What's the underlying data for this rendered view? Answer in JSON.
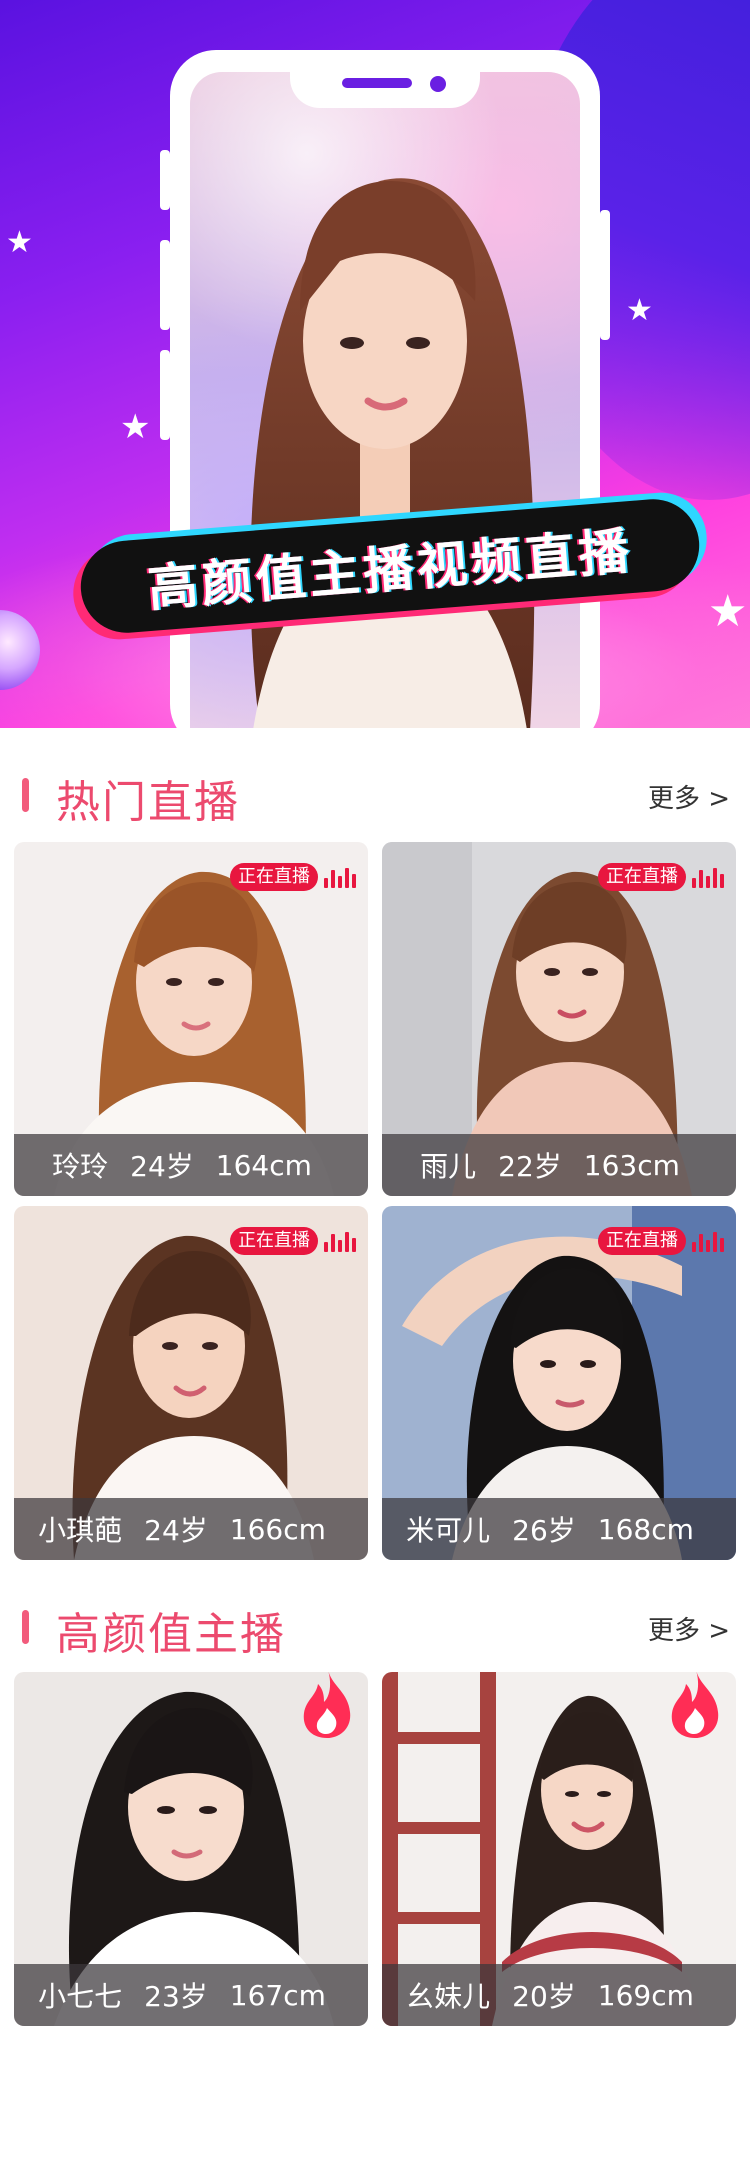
{
  "hero": {
    "banner_text": "高颜值主播视频直播"
  },
  "sections": {
    "hot": {
      "title": "热门直播",
      "more": "更多 >"
    },
    "beauty": {
      "title": "高颜值主播",
      "more": "更多 >"
    }
  },
  "hot_cards": [
    {
      "name": "玲玲",
      "age": "24岁",
      "height": "164cm",
      "badge": "正在直播"
    },
    {
      "name": "雨儿",
      "age": "22岁",
      "height": "163cm",
      "badge": "正在直播"
    },
    {
      "name": "小琪葩",
      "age": "24岁",
      "height": "166cm",
      "badge": "正在直播"
    },
    {
      "name": "米可儿",
      "age": "26岁",
      "height": "168cm",
      "badge": "正在直播"
    }
  ],
  "beauty_cards": [
    {
      "name": "小七七",
      "age": "23岁",
      "height": "167cm"
    },
    {
      "name": "幺妹儿",
      "age": "20岁",
      "height": "169cm"
    }
  ],
  "colors": {
    "accent": "#ec4a6e",
    "live_badge": "#e8163f",
    "hero_purple": "#6a1fe2"
  }
}
